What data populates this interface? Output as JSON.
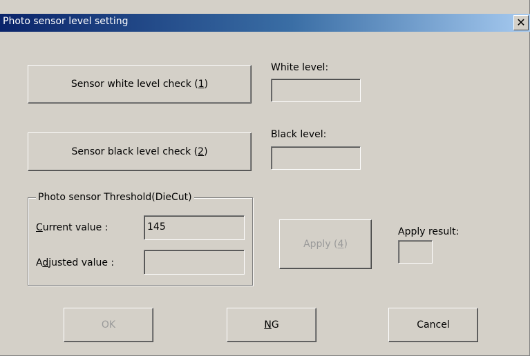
{
  "window": {
    "title": "Photo sensor level setting",
    "close_glyph": "✕"
  },
  "white_check_button": {
    "pre": "Sensor white level check (",
    "key": "1",
    "post": ")"
  },
  "white_level": {
    "label": "White level:",
    "value": ""
  },
  "black_check_button": {
    "pre": "Sensor black level check (",
    "key": "2",
    "post": ")"
  },
  "black_level": {
    "label": "Black level:",
    "value": ""
  },
  "threshold_group": {
    "title": "Photo sensor Threshold(DieCut)",
    "current_label_key": "C",
    "current_label_rest": "urrent value :",
    "current_value": "145",
    "adjusted_label_pre": "A",
    "adjusted_label_key": "d",
    "adjusted_label_rest": "justed value :",
    "adjusted_value": ""
  },
  "apply_button": {
    "pre": "Apply (",
    "key": "4",
    "post": ")",
    "disabled": true
  },
  "apply_result": {
    "label": "Apply result:",
    "value": ""
  },
  "footer": {
    "ok_label": "OK",
    "ng_key": "N",
    "ng_rest": "G",
    "cancel_label": "Cancel"
  },
  "icons": {
    "close": "close-icon"
  }
}
